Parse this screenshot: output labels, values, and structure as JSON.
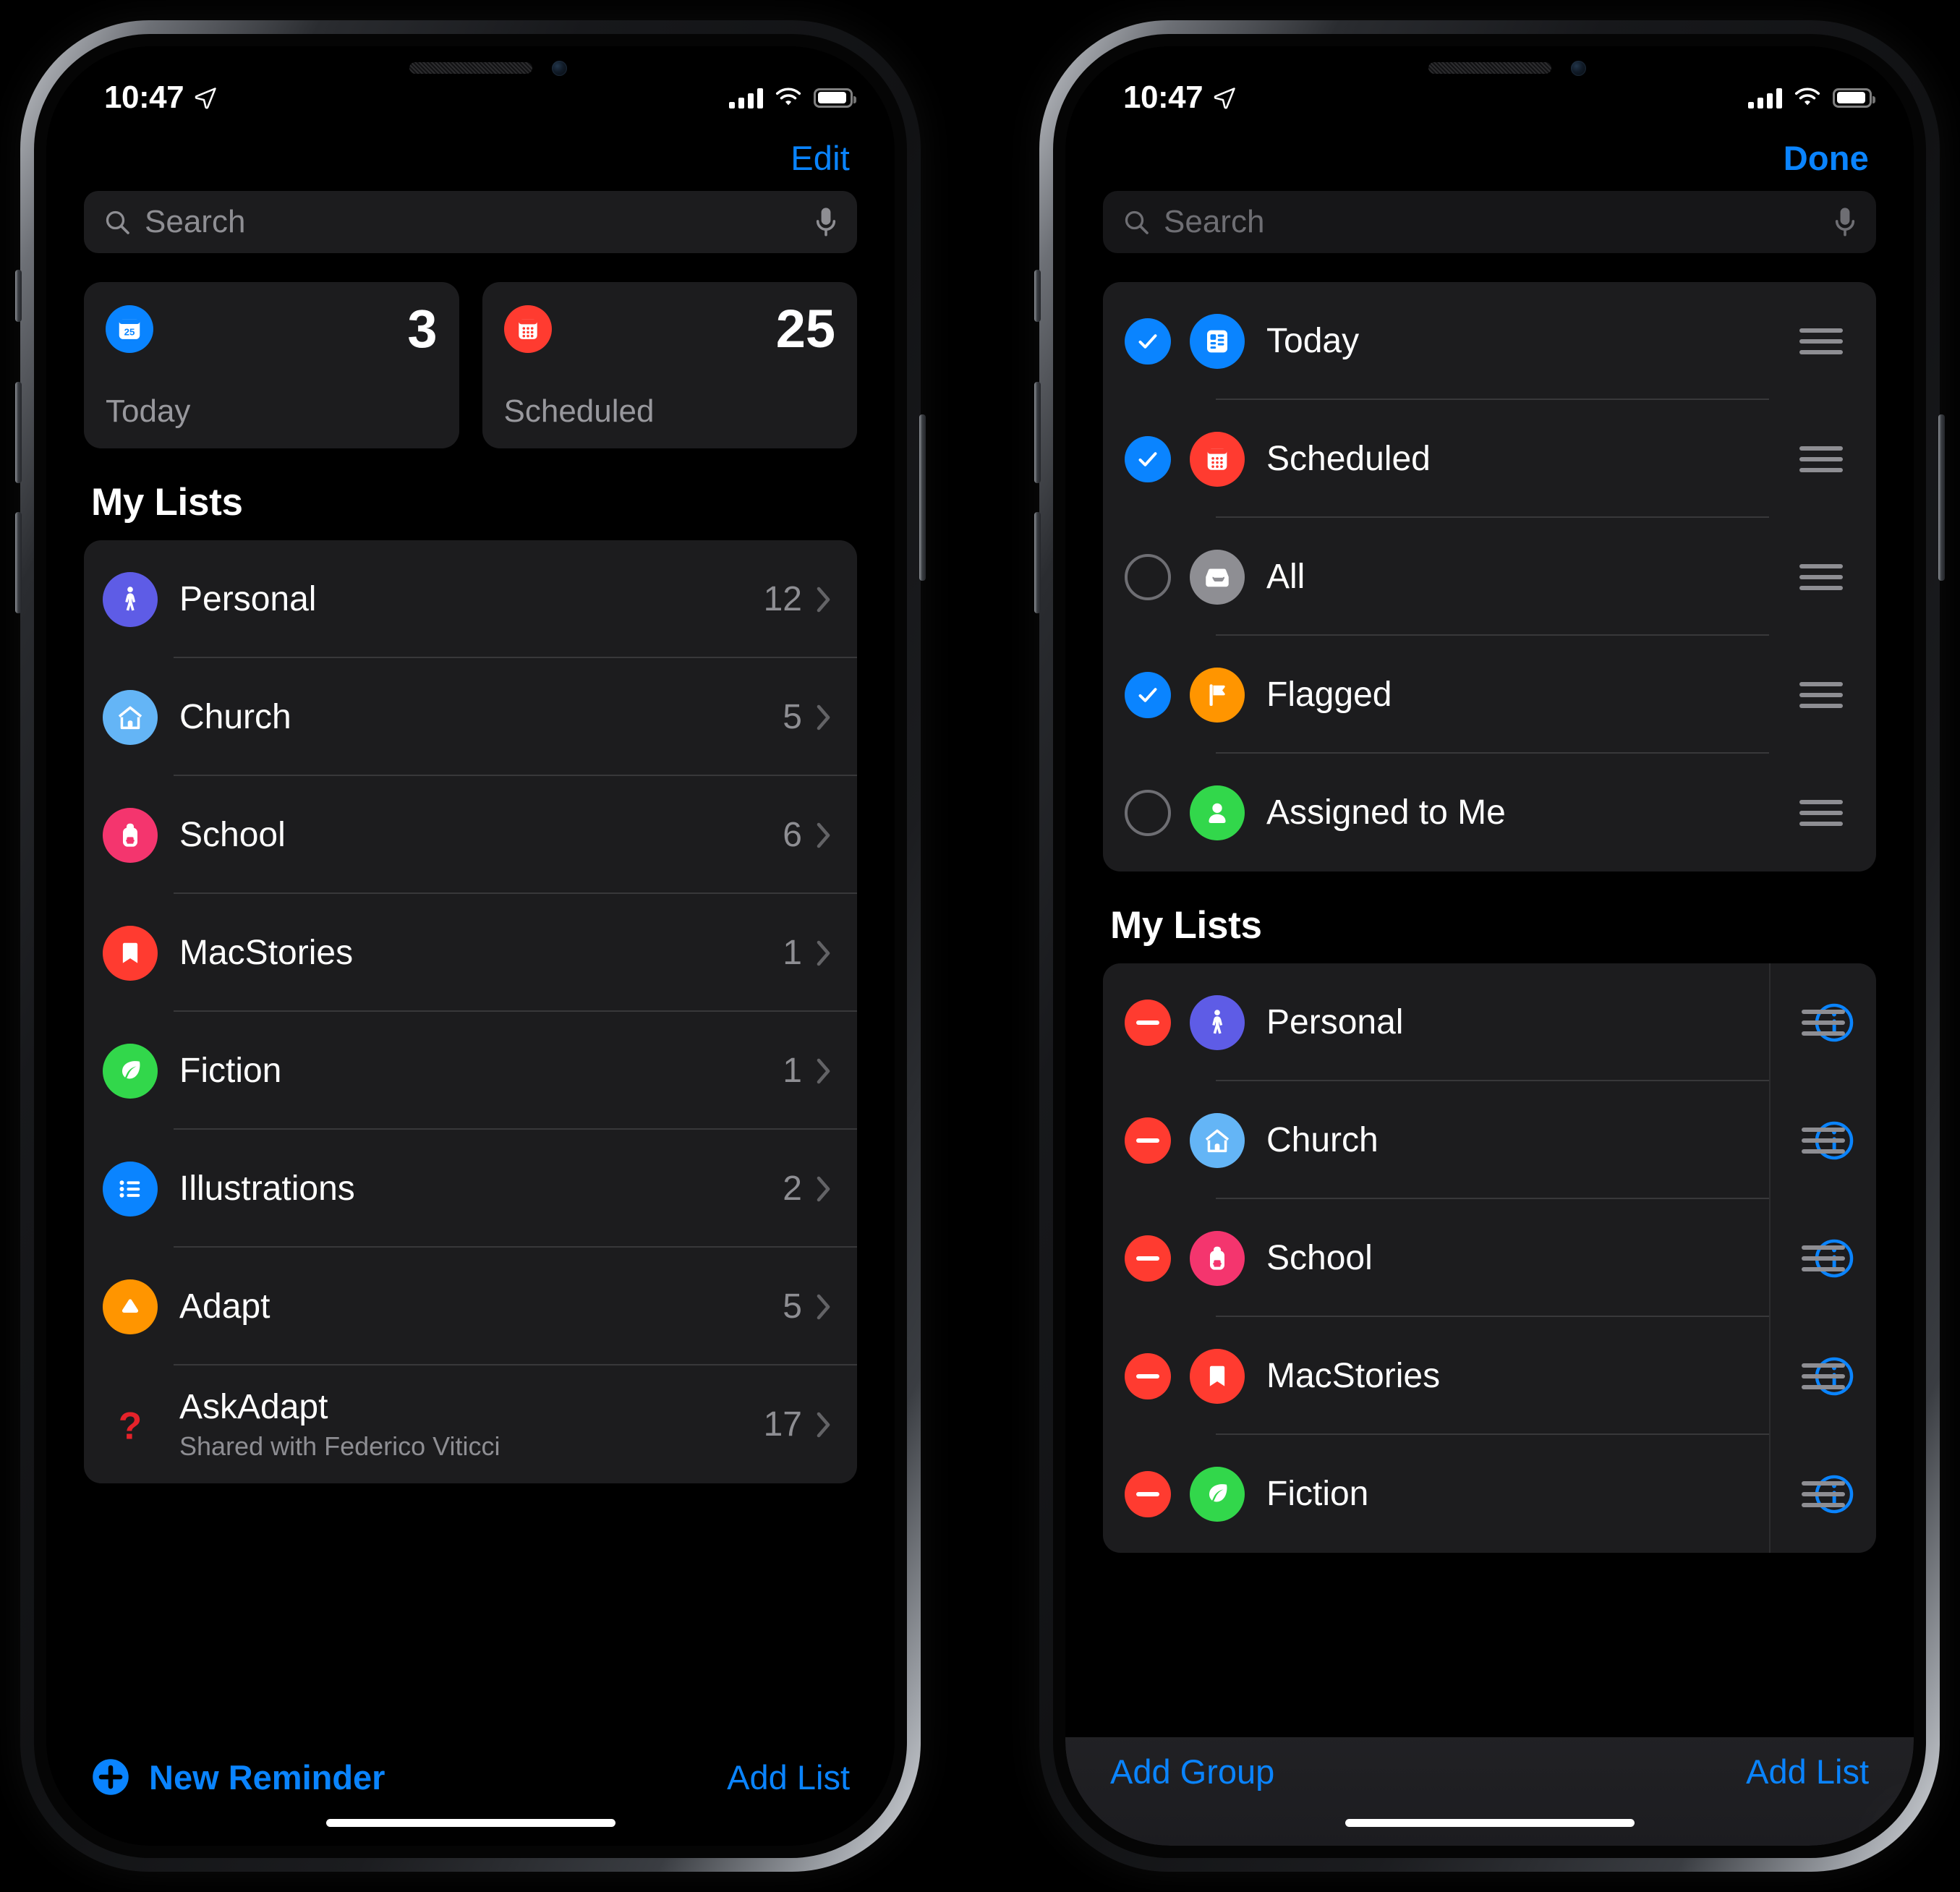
{
  "status_bar": {
    "time": "10:47",
    "location_icon": "location-arrow-icon",
    "signal_icon": "cellular-signal-icon",
    "wifi_icon": "wifi-icon",
    "battery_icon": "battery-icon"
  },
  "left_phone": {
    "nav_action": "Edit",
    "search": {
      "placeholder": "Search",
      "value": "",
      "mic_icon": "microphone-icon",
      "search_icon": "search-icon"
    },
    "cards": [
      {
        "label": "Today",
        "count": "3",
        "icon": "calendar-day-icon",
        "color": "#0a84ff"
      },
      {
        "label": "Scheduled",
        "count": "25",
        "icon": "calendar-icon",
        "color": "#ff3b30"
      }
    ],
    "section_title": "My Lists",
    "lists": [
      {
        "name": "Personal",
        "count": "12",
        "icon": "person-walking-icon",
        "color": "#5e5ce6",
        "subtitle": ""
      },
      {
        "name": "Church",
        "count": "5",
        "icon": "house-icon",
        "color": "#64b5f6",
        "subtitle": ""
      },
      {
        "name": "School",
        "count": "6",
        "icon": "backpack-icon",
        "color": "#f4356e",
        "subtitle": ""
      },
      {
        "name": "MacStories",
        "count": "1",
        "icon": "bookmark-icon",
        "color": "#ff3b30",
        "subtitle": ""
      },
      {
        "name": "Fiction",
        "count": "1",
        "icon": "leaf-icon",
        "color": "#32d74b",
        "subtitle": ""
      },
      {
        "name": "Illustrations",
        "count": "2",
        "icon": "list-bullet-icon",
        "color": "#0a84ff",
        "subtitle": ""
      },
      {
        "name": "Adapt",
        "count": "5",
        "icon": "triangle-icon",
        "color": "#ff9500",
        "subtitle": ""
      },
      {
        "name": "AskAdapt",
        "count": "17",
        "icon": "question-mark-icon",
        "color": "#000000",
        "subtitle": "Shared with Federico Viticci"
      }
    ],
    "toolbar": {
      "new_reminder_label": "New Reminder",
      "new_reminder_icon": "plus-circle-icon",
      "add_list_label": "Add List"
    }
  },
  "right_phone": {
    "nav_action": "Done",
    "search": {
      "placeholder": "Search",
      "value": "",
      "mic_icon": "microphone-icon",
      "search_icon": "search-icon"
    },
    "smart_lists": [
      {
        "name": "Today",
        "selected": true,
        "icon": "today-card-icon",
        "color": "#0a84ff",
        "grip_icon": "drag-handle-icon"
      },
      {
        "name": "Scheduled",
        "selected": true,
        "icon": "calendar-icon",
        "color": "#ff3b30",
        "grip_icon": "drag-handle-icon"
      },
      {
        "name": "All",
        "selected": false,
        "icon": "inbox-tray-icon",
        "color": "#8e8e93",
        "grip_icon": "drag-handle-icon"
      },
      {
        "name": "Flagged",
        "selected": true,
        "icon": "flag-icon",
        "color": "#ff9500",
        "grip_icon": "drag-handle-icon"
      },
      {
        "name": "Assigned to Me",
        "selected": false,
        "icon": "person-icon",
        "color": "#32d74b",
        "grip_icon": "drag-handle-icon"
      }
    ],
    "section_title": "My Lists",
    "lists": [
      {
        "name": "Personal",
        "icon": "person-walking-icon",
        "color": "#5e5ce6",
        "delete_icon": "remove-circle-icon",
        "info_icon": "info-circle-icon",
        "grip_icon": "drag-handle-icon"
      },
      {
        "name": "Church",
        "icon": "house-icon",
        "color": "#64b5f6",
        "delete_icon": "remove-circle-icon",
        "info_icon": "info-circle-icon",
        "grip_icon": "drag-handle-icon"
      },
      {
        "name": "School",
        "icon": "backpack-icon",
        "color": "#f4356e",
        "delete_icon": "remove-circle-icon",
        "info_icon": "info-circle-icon",
        "grip_icon": "drag-handle-icon"
      },
      {
        "name": "MacStories",
        "icon": "bookmark-icon",
        "color": "#ff3b30",
        "delete_icon": "remove-circle-icon",
        "info_icon": "info-circle-icon",
        "grip_icon": "drag-handle-icon"
      },
      {
        "name": "Fiction",
        "icon": "leaf-icon",
        "color": "#32d74b",
        "delete_icon": "remove-circle-icon",
        "info_icon": "info-circle-icon",
        "grip_icon": "drag-handle-icon"
      }
    ],
    "toolbar": {
      "add_group_label": "Add Group",
      "add_list_label": "Add List"
    }
  },
  "colors": {
    "accent_blue": "#0a84ff",
    "destructive_red": "#ff3b30",
    "group_bg": "#1c1c1e",
    "secondary_text": "#8e8e93"
  }
}
